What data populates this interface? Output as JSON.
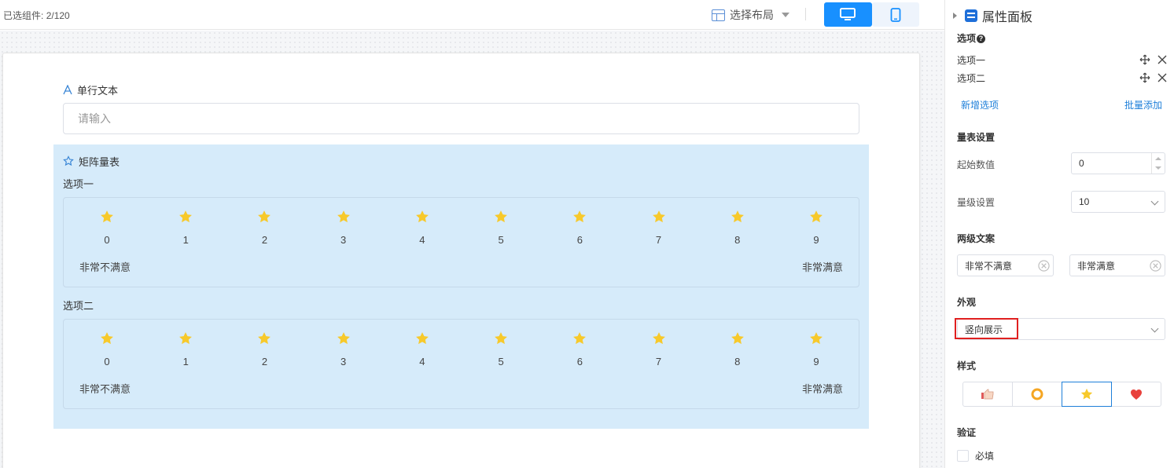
{
  "topbar": {
    "selected_label": "已选组件:",
    "selected_count": "2/120",
    "layout_label": "选择布局"
  },
  "form": {
    "text_field": {
      "label": "单行文本",
      "placeholder": "请输入"
    },
    "matrix_field": {
      "label": "矩阵量表",
      "rows": [
        {
          "title": "选项一",
          "low_label": "非常不满意",
          "high_label": "非常满意"
        },
        {
          "title": "选项二",
          "low_label": "非常不满意",
          "high_label": "非常满意"
        }
      ],
      "scale_values": [
        "0",
        "1",
        "2",
        "3",
        "4",
        "5",
        "6",
        "7",
        "8",
        "9"
      ],
      "star_color": "#f7c92b"
    }
  },
  "panel": {
    "title": "属性面板",
    "options_title": "选项",
    "options": [
      "选项一",
      "选项二"
    ],
    "add_option": "新增选项",
    "batch_add": "批量添加",
    "scale_settings_title": "量表设置",
    "start_value_label": "起始数值",
    "start_value": "0",
    "level_label": "量级设置",
    "level_value": "10",
    "two_level_title": "两级文案",
    "low_text": "非常不满意",
    "high_text": "非常满意",
    "appearance_title": "外观",
    "appearance_value": "竖向展示",
    "style_title": "样式",
    "style_options": [
      "thumb-icon",
      "ring-icon",
      "star-icon",
      "heart-icon"
    ],
    "selected_style": "star-icon",
    "validation_title": "验证",
    "required_label": "必填"
  },
  "colors": {
    "accent": "#1890ff",
    "matrix_bg": "#d6ebfa",
    "highlight_border": "#e02020"
  }
}
